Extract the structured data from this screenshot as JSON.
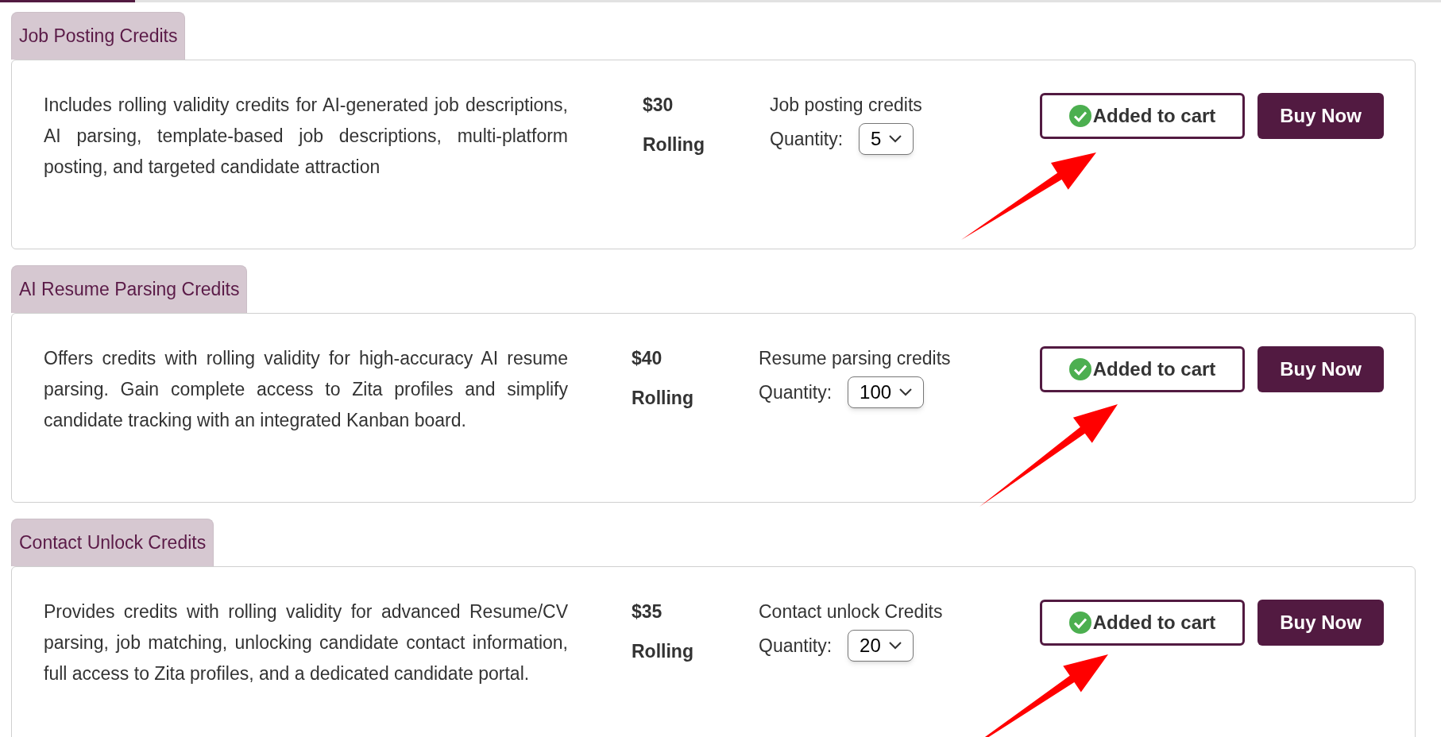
{
  "sections": [
    {
      "tab": "Job Posting Credits",
      "description": "Includes rolling validity credits for AI-generated job descriptions, AI parsing, template-based job descriptions, multi-platform posting, and targeted candidate attraction",
      "price": "$30",
      "validity": "Rolling",
      "credit_label": "Job posting credits",
      "quantity_label": "Quantity:",
      "quantity": "5",
      "cart_button": "Added to cart",
      "added": true,
      "buy_button": "Buy Now"
    },
    {
      "tab": "AI Resume Parsing Credits",
      "description": "Offers credits with rolling validity for high-accuracy AI resume parsing. Gain complete access to Zita profiles and simplify candidate tracking with an integrated Kanban board.",
      "price": "$40",
      "validity": "Rolling",
      "credit_label": "Resume parsing credits",
      "quantity_label": "Quantity:",
      "quantity": "100",
      "cart_button": "Added to cart",
      "added": true,
      "buy_button": "Buy Now"
    },
    {
      "tab": "Contact Unlock Credits",
      "description": "Provides credits with rolling validity for advanced Resume/CV parsing, job matching, unlocking candidate contact information, full access to Zita profiles, and a dedicated candidate portal.",
      "price": "$35",
      "validity": "Rolling",
      "credit_label": "Contact unlock Credits",
      "quantity_label": "Quantity:",
      "quantity": "20",
      "cart_button": "Added to cart",
      "added": true,
      "buy_button": "Buy Now"
    }
  ]
}
